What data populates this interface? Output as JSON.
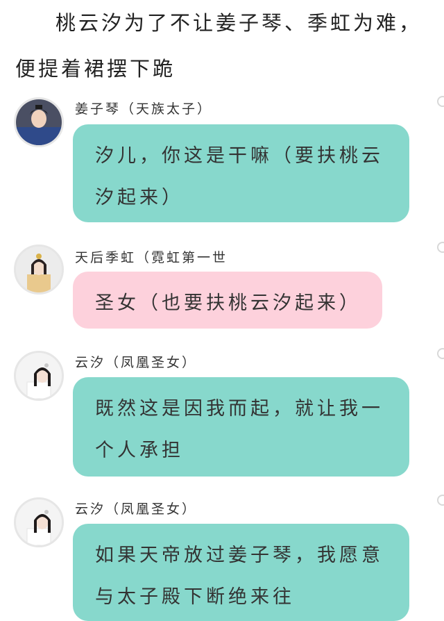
{
  "intro": "桃云汐为了不让姜子琴、季虹为难，便提着裙摆下跪",
  "messages": [
    {
      "speaker": "姜子琴（天族太子）",
      "text": "汐儿，你这是干嘛（要扶桃云汐起来）",
      "color": "#87d8cc",
      "avatar": "prince-avatar"
    },
    {
      "speaker": "天后季虹（霓虹第一世",
      "text": "圣女（也要扶桃云汐起来）",
      "color": "#fdd1dc",
      "avatar": "empress-avatar"
    },
    {
      "speaker": "云汐（凤凰圣女）",
      "text": "既然这是因我而起，就让我一个人承担",
      "color": "#87d8cc",
      "avatar": "yunxi-avatar"
    },
    {
      "speaker": "云汐（凤凰圣女）",
      "text": "如果天帝放过姜子琴，我愿意与太子殿下断绝来往",
      "color": "#87d8cc",
      "avatar": "yunxi-avatar"
    }
  ]
}
